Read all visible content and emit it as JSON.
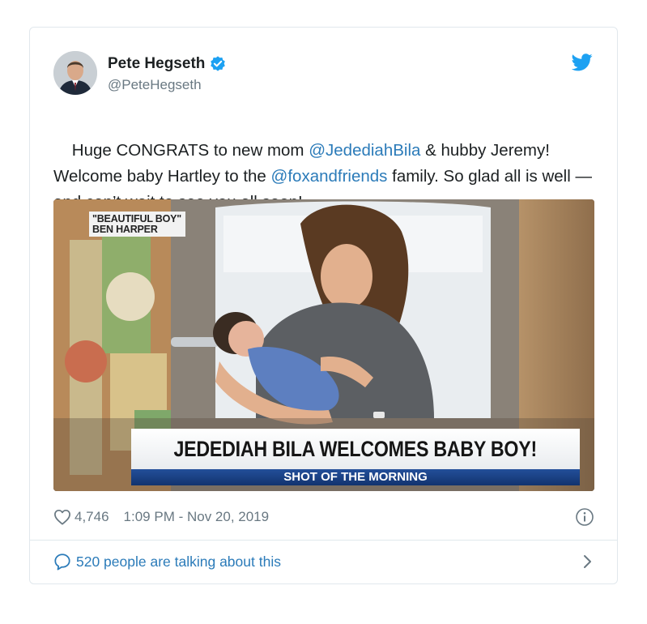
{
  "author": {
    "display_name": "Pete Hegseth",
    "handle": "@PeteHegseth",
    "verified": true,
    "avatar_icon": "avatar-photo"
  },
  "brand_icon": "twitter-bird-icon",
  "tweet": {
    "segments": [
      {
        "text": "Huge CONGRATS to new mom ",
        "type": "text"
      },
      {
        "text": "@JedediahBila",
        "type": "mention"
      },
      {
        "text": " & hubby Jeremy! Welcome baby Hartley to the ",
        "type": "text"
      },
      {
        "text": "@foxandfriends",
        "type": "mention"
      },
      {
        "text": " family. So glad all is well — and can’t wait to see you all soon!",
        "type": "text"
      }
    ]
  },
  "media": {
    "music_tag_line1": "\"BEAUTIFUL BOY\"",
    "music_tag_line2": "BEN HARPER",
    "headline": "JEDEDIAH BILA WELCOMES BABY BOY!",
    "ticker": "SHOT OF THE MORNING"
  },
  "meta": {
    "likes": "4,746",
    "timestamp": "1:09 PM - Nov 20, 2019"
  },
  "conversation": {
    "label": "520 people are talking about this"
  },
  "colors": {
    "link": "#2b7bb9",
    "muted": "#697882",
    "verified": "#1da1f2",
    "bird": "#1da1f2",
    "border": "#e1e8ed"
  }
}
